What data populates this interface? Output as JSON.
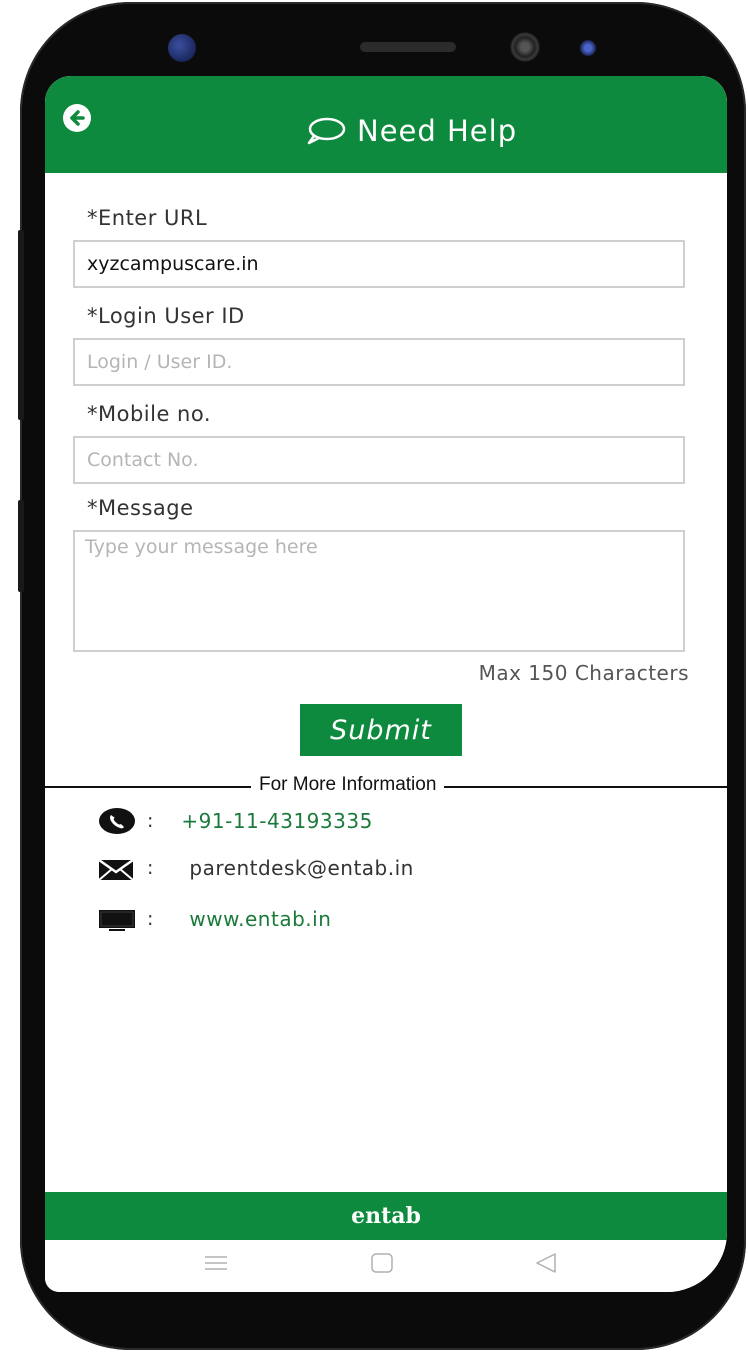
{
  "header": {
    "title": "Need Help"
  },
  "form": {
    "url_label": "*Enter URL",
    "url_value": "xyzcampuscare.in",
    "login_label": "*Login User ID",
    "login_placeholder": "Login / User ID.",
    "mobile_label": "*Mobile no.",
    "mobile_placeholder": "Contact No.",
    "message_label": "*Message",
    "message_placeholder": "Type your message here",
    "max_chars": "Max 150 Characters",
    "submit_label": "Submit"
  },
  "info": {
    "heading": "For More Information",
    "colon": ":",
    "phone": "+91-11-43193335",
    "email": "parentdesk@entab.in",
    "website": "www.entab.in"
  },
  "footer": {
    "logo": "entab"
  },
  "colors": {
    "brand_green": "#0e8a3e",
    "link_green": "#1b7a3b"
  }
}
